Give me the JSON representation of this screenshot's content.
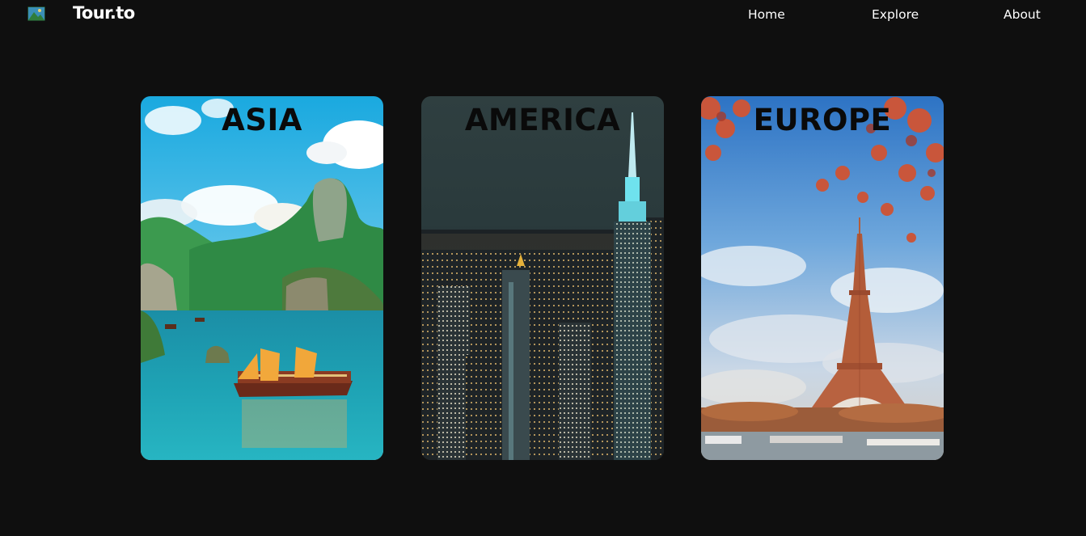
{
  "navbar": {
    "logo_icon": "map-image-icon",
    "brand": "Tour.to",
    "links": [
      {
        "label": "Home"
      },
      {
        "label": "Explore"
      },
      {
        "label": "About"
      }
    ]
  },
  "cards": [
    {
      "title": "ASIA",
      "image": "ha-long-bay-junk-boat"
    },
    {
      "title": "AMERICA",
      "image": "new-york-night-skyline"
    },
    {
      "title": "EUROPE",
      "image": "eiffel-tower-autumn"
    }
  ],
  "colors": {
    "background": "#0f0f0f",
    "nav_text": "#ffffff",
    "card_title": "#0a0a0a"
  }
}
